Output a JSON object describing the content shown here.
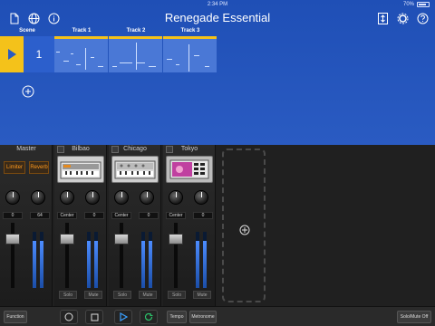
{
  "status": {
    "time": "2:34 PM",
    "battery": "70%"
  },
  "app": {
    "title": "Renegade Essential"
  },
  "grid": {
    "scene_header": "Scene",
    "tracks": [
      "Track 1",
      "Track 2",
      "Track 3"
    ],
    "scene_number": "1"
  },
  "mixer": {
    "master": {
      "name": "Master",
      "fx": [
        "Limiter",
        "Reverb"
      ],
      "knob_values": [
        "0",
        "64"
      ]
    },
    "strips": [
      {
        "name": "Bilbao",
        "knob_values": [
          "Center",
          "0"
        ],
        "solo": "Solo",
        "mute": "Mute"
      },
      {
        "name": "Chicago",
        "knob_values": [
          "Center",
          "0"
        ],
        "solo": "Solo",
        "mute": "Mute"
      },
      {
        "name": "Tokyo",
        "knob_values": [
          "Center",
          "0"
        ],
        "solo": "Solo",
        "mute": "Mute"
      }
    ]
  },
  "toolbar": {
    "function": "Function",
    "tempo": "Tempo",
    "metronome": "Metronome",
    "solo_mute_off": "Solo/Mute Off"
  },
  "colors": {
    "accent": "#f4c21a",
    "blue": "#2a5bc2",
    "fx_orange": "#ff9a1e",
    "play_blue": "#3aa0ff",
    "loop_green": "#2cc36b"
  }
}
